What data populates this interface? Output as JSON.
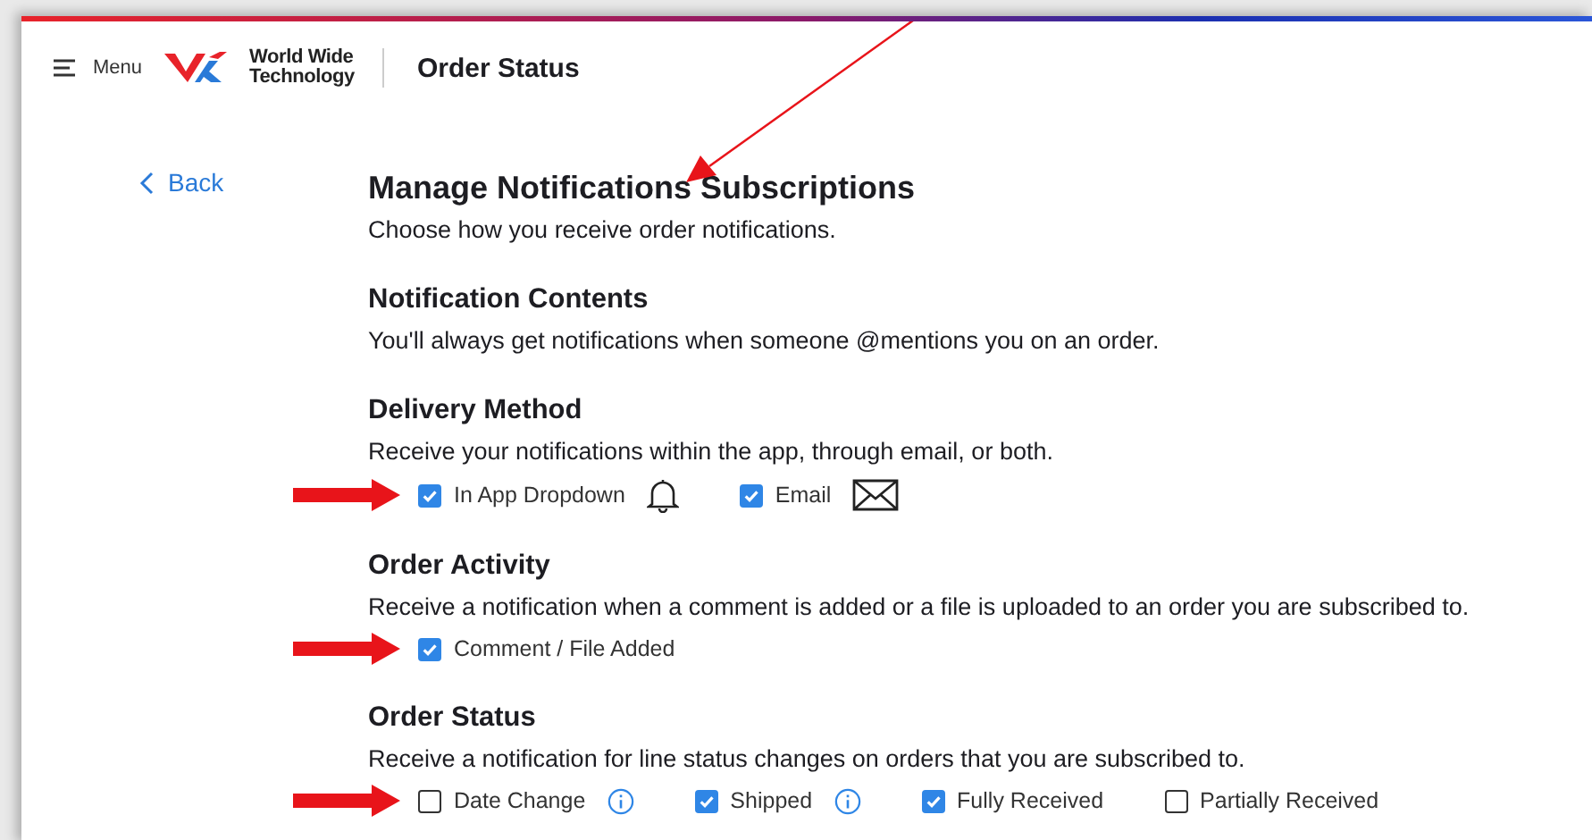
{
  "header": {
    "menu_label": "Menu",
    "logo_text": [
      "World Wide",
      "Technology"
    ],
    "app_title": "Order Status"
  },
  "back_link": "Back",
  "page": {
    "title": "Manage Notifications Subscriptions",
    "subtitle": "Choose how you receive order notifications."
  },
  "sections": [
    {
      "title": "Notification Contents",
      "description": "You'll always get notifications when someone @mentions you on an order."
    },
    {
      "title": "Delivery Method",
      "description": "Receive your notifications within the app, through email, or both.",
      "flagged": true,
      "options": [
        {
          "label": "In App Dropdown",
          "checked": true,
          "kind": "app"
        },
        {
          "label": "Email",
          "checked": true,
          "kind": "email"
        }
      ]
    },
    {
      "title": "Order Activity",
      "description": "Receive a notification when a comment is added or a file is uploaded to an order you are subscribed to.",
      "flagged": true,
      "options": [
        {
          "label": "Comment / File Added",
          "checked": true,
          "kind": "plain"
        }
      ]
    },
    {
      "title": "Order Status",
      "description": "Receive a notification for line status changes on orders that you are subscribed to.",
      "flagged": true,
      "options": [
        {
          "label": "Date Change",
          "checked": false,
          "kind": "info"
        },
        {
          "label": "Shipped",
          "checked": true,
          "kind": "info"
        },
        {
          "label": "Fully Received",
          "checked": true,
          "kind": "plain"
        },
        {
          "label": "Partially Received",
          "checked": false,
          "kind": "plain"
        }
      ]
    }
  ]
}
